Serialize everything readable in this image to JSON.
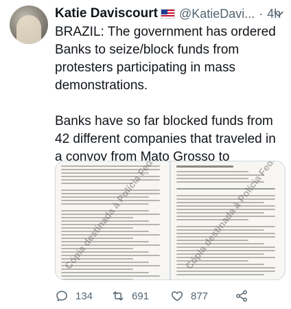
{
  "author": {
    "name": "Katie Daviscourt",
    "flag_icon": "us-flag-icon",
    "handle": "@KatieDavi...",
    "separator": "·",
    "time": "4h"
  },
  "tweet": {
    "paragraphs": [
      "BRAZIL: The government has ordered Banks to seize/block funds from protesters participating in mass demonstrations.",
      "Banks have so far blocked funds from 42 different companies that traveled in a convoy from Mato Grosso to participate."
    ]
  },
  "media": {
    "left_watermark": "Cópia destinada à Polícia Federal",
    "right_watermark": "Cópia destinada à Polícia Federal"
  },
  "actions": {
    "reply_count": "134",
    "retweet_count": "691",
    "like_count": "877"
  },
  "colors": {
    "text": "#0f1419",
    "secondary": "#536471",
    "border": "#cfd9de"
  }
}
